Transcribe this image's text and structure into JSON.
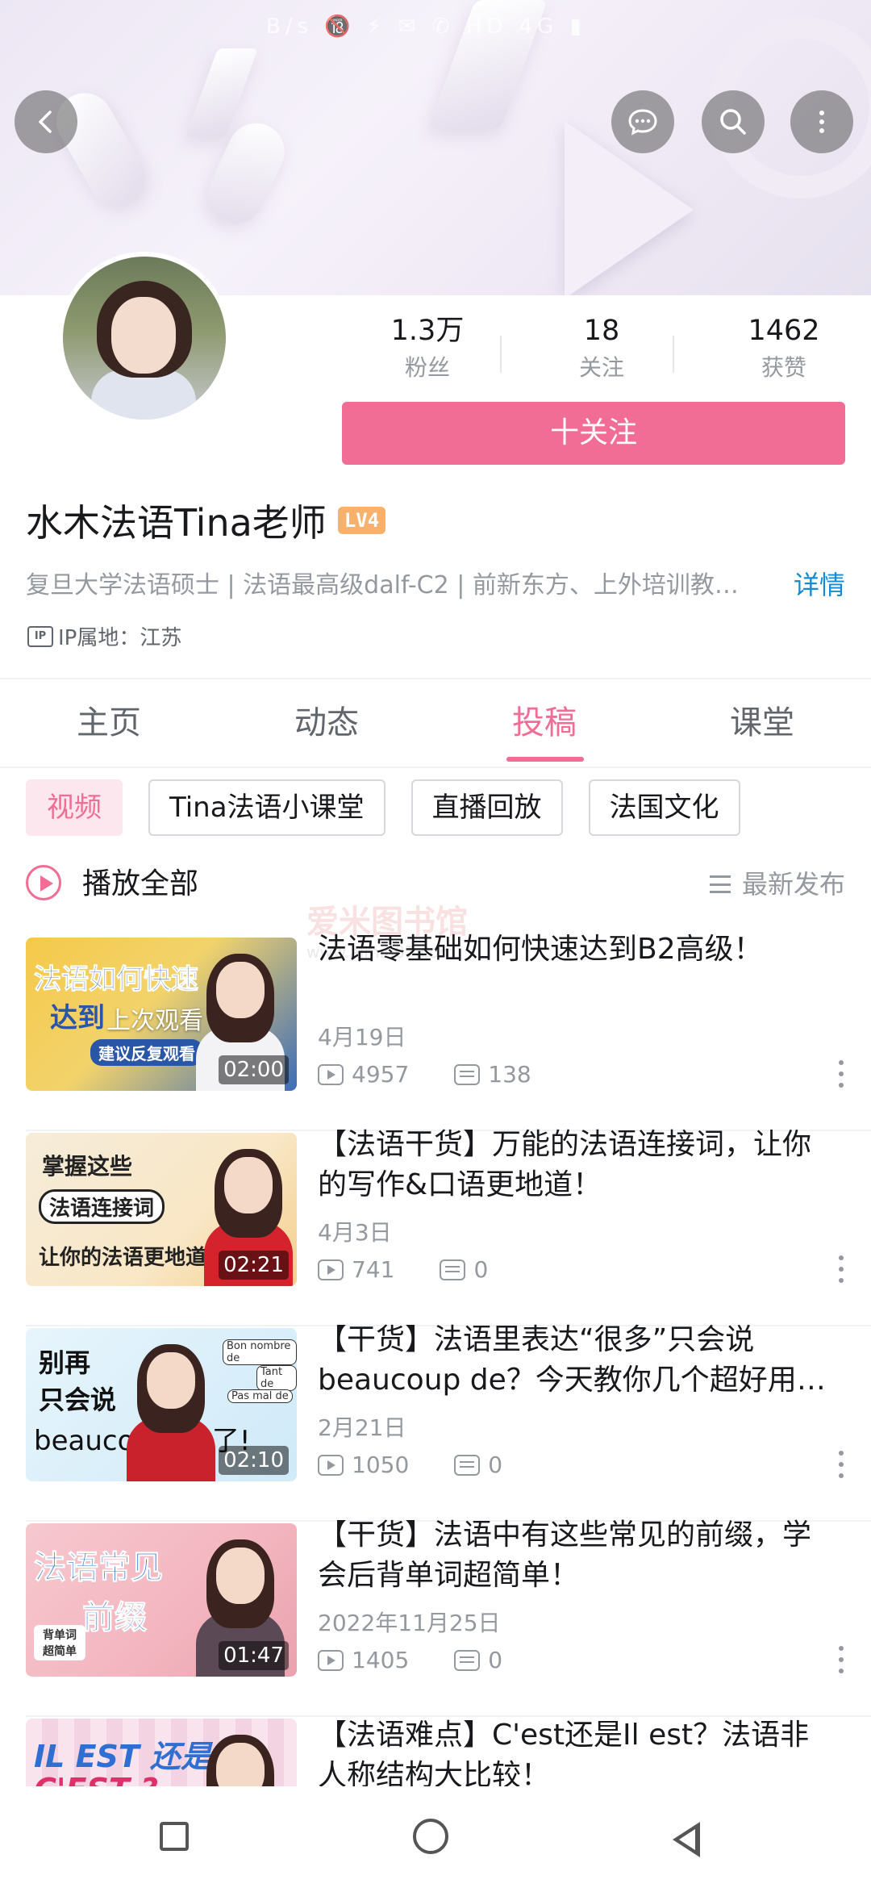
{
  "status_bar": {
    "text": "B/s 🔞 ⚡ ✉ ✆ HD 4G ▮"
  },
  "header": {
    "back_icon": "chevron-left-icon",
    "actions": [
      "chat-icon",
      "search-icon",
      "more-vertical-icon"
    ]
  },
  "profile": {
    "name": "水木法语Tina老师",
    "level": "LV4",
    "stats": [
      {
        "value": "1.3万",
        "label": "粉丝"
      },
      {
        "value": "18",
        "label": "关注"
      },
      {
        "value": "1462",
        "label": "获赞"
      }
    ],
    "follow_label": "十关注",
    "bio": "复旦大学法语硕士 | 法语最高级dalf-C2 | 前新东方、上外培训教…",
    "detail_label": "详情",
    "ip_icon_text": "IP",
    "ip_location": "IP属地：江苏"
  },
  "tabs": [
    {
      "label": "主页",
      "active": false
    },
    {
      "label": "动态",
      "active": false
    },
    {
      "label": "投稿",
      "active": true
    },
    {
      "label": "课堂",
      "active": false
    }
  ],
  "filters": [
    {
      "label": "视频",
      "active": true
    },
    {
      "label": "Tina法语小课堂",
      "active": false
    },
    {
      "label": "直播回放",
      "active": false
    },
    {
      "label": "法国文化",
      "active": false
    }
  ],
  "list_header": {
    "play_all_label": "播放全部",
    "sort_label": "最新发布"
  },
  "watermark": {
    "main": "爱米图书馆",
    "sub": "www.aimi007.com"
  },
  "videos": [
    {
      "title": "法语零基础如何快速达到B2高级！",
      "date": "4月19日",
      "plays": "4957",
      "danmaku": "138",
      "duration": "02:00",
      "resume_label": "上次观看",
      "thumb_lines": [
        "法语如何快速",
        "达到",
        "建议反复观看"
      ],
      "thumb_bg": "#2f5fa8"
    },
    {
      "title": "【法语干货】万能的法语连接词，让你的写作&口语更地道！",
      "date": "4月3日",
      "plays": "741",
      "danmaku": "0",
      "duration": "02:21",
      "thumb_lines": [
        "掌握这些",
        "法语连接词",
        "让你的法语更地道"
      ],
      "thumb_bg": "#f6ecd9"
    },
    {
      "title": "【干货】法语里表达“很多”只会说beaucoup de？今天教你几个超好用表…",
      "date": "2月21日",
      "plays": "1050",
      "danmaku": "0",
      "duration": "02:10",
      "thumb_lines": [
        "别再",
        "只会说",
        "beaucoup de了!",
        "Bon nombre de",
        "Tant de",
        "Pas mal de"
      ],
      "thumb_bg": "#dff1fb"
    },
    {
      "title": "【干货】法语中有这些常见的前缀，学会后背单词超简单！",
      "date": "2022年11月25日",
      "plays": "1405",
      "danmaku": "0",
      "duration": "01:47",
      "thumb_lines": [
        "法语常见",
        "前缀",
        "背单词 超简单"
      ],
      "thumb_bg": "#f7c8cf"
    },
    {
      "title": "【法语难点】C'est还是Il est？法语非人称结构大比较！",
      "thumb_lines": [
        "IL EST 还是",
        "C'EST ?"
      ],
      "thumb_bg": "#f5d9e6"
    }
  ],
  "navbar": [
    "square-icon",
    "circle-icon",
    "back-triangle-icon"
  ]
}
